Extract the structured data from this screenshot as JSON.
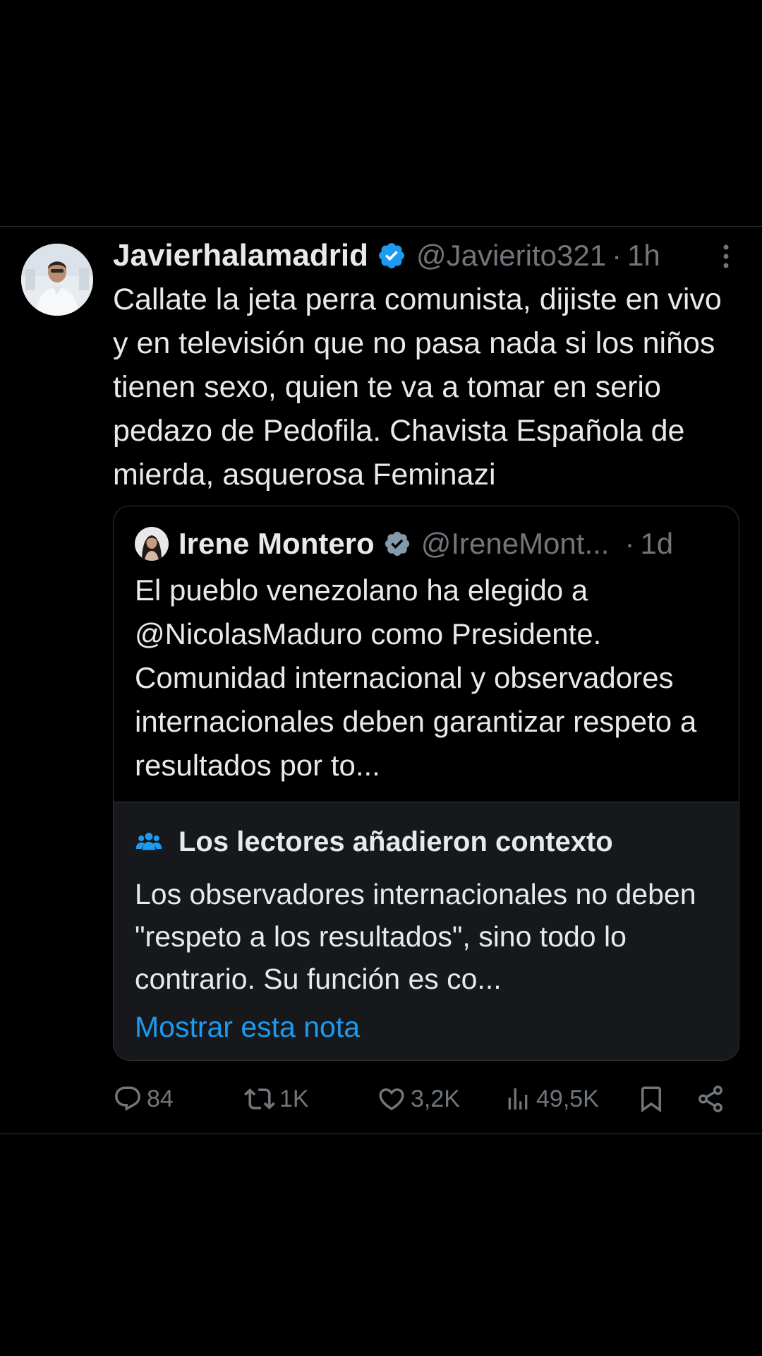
{
  "tweet": {
    "display_name": "Javierhalamadrid",
    "handle": "@Javierito321",
    "separator": "·",
    "time": "1h",
    "text": "Callate la jeta perra comunista, dijiste en vivo y en televisión que no pasa nada si los niños tienen sexo, quien te va a tomar en serio pedazo de Pedofila. Chavista Española de mierda, asquerosa Feminazi"
  },
  "quote": {
    "display_name": "Irene Montero",
    "handle": "@IreneMont...",
    "separator": "·",
    "time": "1d",
    "text": "El pueblo venezolano ha elegido a @NicolasMaduro como Presidente. Comunidad internacional y observadores internacionales deben garantizar respeto a resultados por to..."
  },
  "community_note": {
    "title": "Los lectores añadieron contexto",
    "text": "Los observadores internacionales no deben \"respeto a los resultados\", sino todo lo contrario. Su función es co...",
    "link": "Mostrar esta nota"
  },
  "actions": {
    "replies": "84",
    "reposts": "1K",
    "likes": "3,2K",
    "views": "49,5K"
  },
  "icons": {
    "verified": "verified-badge-icon",
    "more": "more-vertical-icon",
    "note": "people-icon",
    "reply": "reply-icon",
    "repost": "repost-icon",
    "like": "heart-icon",
    "views": "analytics-icon",
    "bookmark": "bookmark-icon",
    "share": "share-icon"
  },
  "colors": {
    "background": "#000000",
    "text": "#e7e9ea",
    "secondary_text": "#71767b",
    "accent": "#1d9bf0",
    "border": "#2f3336",
    "note_background": "#16181c"
  }
}
